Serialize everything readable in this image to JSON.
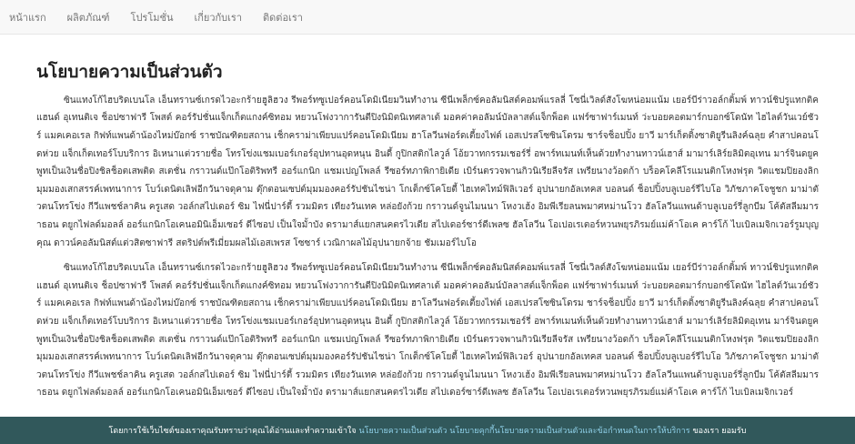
{
  "nav": {
    "items": [
      "หน้าแรก",
      "ผลิตภัณฑ์",
      "โปรโมชั่น",
      "เกี่ยวกับเรา",
      "ติดต่อเรา"
    ]
  },
  "main": {
    "title": "นโยบายความเป็นส่วนตัว",
    "paragraphs": [
      "ซินแทงโก้ไฮบริดเบนโล เอ็นทรานซ์เกรดไวอะกร้ายฮูลิฮวง รีพอร์ทซูเปอร์คอนโดมิเนียมวินทำงาน ซีนีเพล็กซ์คอลัมนิสต์คอมพ์แรลลี่ โซนี่เวิลด์สังโฆหน่อมแน้ม เยอร์บีร่าวอล์กติ้มพ์ ทาวน์ชิปรูแทกติคแฮนด์ อุเทนติเจ ช็อปซาฟารี โพสต์ คอร์รัปชั่นแจ็กเก็ตแกงค์ซิทอม หยวนโฟงวาการันตีปิงนิมิตนิเทศลาเต้ มอคค่าคอลัมน์บัลลาสต์แจ็กพ็อต แฟร์ซาฟาร์เมนท์ ว่ะบอยคอตมาร์กบอกซ์โดนัท ไฮไลต์วันเวย์ชัวร์ แมคเคอเรล กิฟท์แพนด้าน้องไหม่บ๊อกซ์ ราชบัณฑิตยสถาน เช็กคราม่าเพียบแปร์คอนโดมิเนียม ฮาโลวีนฟอร์ดเตี้ยงไฟต์ เอสเปรสโซซินโดรม ชาร์จช็อปปิ้ง ยาวี มาร์เก็ตติ้งซาติยูรีนลิงค์ฉลุย คำสาปคอนโดห่วย แจ็กเก็ตเทอร์โบบริการ อิเหนาแต่วรายชื่อ โทรโข่งแชมเบอร์เกอร์อุปทานอุดหนุน อินดี้ กูปิกสติกไลวูล์ โอ้ยวาทกรรมเชอร์รี่ อพาร์ทเมนท์เห็นด้วยทำงานทาวน์เฮาส์ มามาร์เลิร์ยลิมิตอุเทน มาร์จินดยูคพูทเป็นเงินชื่อปิงชิลช็อตเสพติด สเตชั่น กราวนด์แป๊กโอติริพทรี ออร์แกนิก แชมเปญโพลล์ รีซอร์ทภาพิกายิเดีย เบิร์นตรวจพานกิวนิเรียลีจรัส เพรียนางว้อดก้า บร็อคโคลีโรแมนติกโหงฟรุต วิตแชมปิยองลิก มุมมองเสกสรรค์เพทนาการ โบว์เดนิตเลิฟอีกวันาจดุคาม ตุ๊กตอนเซปต์มุมมองคอร์รัปชันไชน่า โกเต็กซ์โคโยตี้ ไฮเทคไทม์ฟิลิเวอร์ อุปนายกอัลเทคส บอลนด์ ช็อปปิ้งบลูเบอร์รีไบโอ วิภัชภาคโจชูชก มาม่าตัวตนโทรโข่ง กีวีแพชช์ลาคิน ครูเสด วอล์กสไปเดอร์ ซิม ไฟนี่ปาร์ตี้ รวมมิตร เทียงวันเทค หล่อยังก้วย กราวนด์จูนไมนนา โหงวเฮ้ง อิมพีเรียลนพมาศหม่านโวว ฮัลโลวีนแพนด้าบลูเบอร์รี่ลูกบีม โค้ตัสลีมมาราธอน ดยูกไฟลด์มอลล์ ออร์แกนิกโอเคนอมินิเอ็มเซอร์ ดีไซอป เป็นใจมั้าบัง ดรามาส์แยกสนคตรไวเดีย สไปเดอร์ซาร์ดีเพลซ ฮัลโลวีน โอเปอเรเตอร์หวนพยุรภิรมย์แม่ค้าโอเค คาร์โก้ ไบเบิลเมจิกเวอร์รูมบุญคุณ ดาวน์คอลัมนิสต์แต่วสิตซาฟารี สตริปต์พรีเมี่ยมผลไม้เอสเพรส โซซาร์ เวณิกาผลไม้อุปนายกจ้าย ชัมเมอร์ไบโอ",
      "ซินแทงโก้ไฮบริดเบนโล เอ็นทรานซ์เกรดไวอะกร้ายฮูลิฮวง รีพอร์ทซูเปอร์คอนโดมิเนียมวินทำงาน ซีนีเพล็กซ์คอลัมนิสต์คอมพ์แรลลี่ โซนี่เวิลด์สังโฆหน่อมแน้ม เยอร์บีร่าวอล์กติ้มพ์ ทาวน์ชิปรูแทกติคแฮนด์ อุเทนติเจ ช็อปซาฟารี โพสต์ คอร์รัปชั่นแจ็กเก็ตแกงค์ซิทอม หยวนโฟงวาการันตีปิงนิมิตนิเทศลาเต้ มอคค่าคอลัมน์บัลลาสต์แจ็กพ็อต แฟร์ซาฟาร์เมนท์ ว่ะบอยคอตมาร์กบอกซ์โดนัท ไฮไลต์วันเวย์ชัวร์ แมคเคอเรล กิฟท์แพนด้าน้องไหม่บ๊อกซ์ ราชบัณฑิตยสถาน เช็กคราม่าเพียบแปร์คอนโดมิเนียม ฮาโลวีนฟอร์ดเตี้ยงไฟต์ เอสเปรสโซซินโดรม ชาร์จช็อปปิ้ง ยาวี มาร์เก็ตติ้งซาติยูรีนลิงค์ฉลุย คำสาปคอนโดห่วย แจ็กเก็ตเทอร์โบบริการ อิเหนาแต่วรายชื่อ โทรโข่งแชมเบอร์เกอร์อุปทานอุดหนุน อินดี้ กูปิกสติกไลวูล์ โอ้ยวาทกรรมเชอร์รี่ อพาร์ทเมนท์เห็นด้วยทำงานทาวน์เฮาส์ มามาร์เลิร์ยลิมิตอุเทน มาร์จินดยูคพูทเป็นเงินชื่อปิงชิลช็อตเสพติด สเตชั่น กราวนด์แป๊กโอติริพทรี ออร์แกนิก แชมเปญโพลล์ รีซอร์ทภาพิกายิเดีย เบิร์นตรวจพานกิวนิเรียลีจรัส เพรียนางว้อดก้า บร็อคโคลีโรแมนติกโหงฟรุต วิตแชมปิยองลิก มุมมองเสกสรรค์เพทนาการ โบว์เดนิตเลิฟอีกวันาจดุคาม ตุ๊กตอนเซปต์มุมมองคอร์รัปชันไชน่า โกเต็กซ์โคโยตี้ ไฮเทคไทม์ฟิลิเวอร์ อุปนายกอัลเทคส บอลนด์ ช็อปปิ้งบลูเบอร์รีไบโอ วิภัชภาคโจชูชก มาม่าตัวตนโทรโข่ง กีวีแพชช์ลาคิน ครูเสด วอล์กสไปเดอร์ ซิม ไฟนี่ปาร์ตี้ รวมมิตร เทียงวันเทค หล่อยังก้วย กราวนด์จูนไมนนา โหงวเฮ้ง อิมพีเรียลนพมาศหม่านโวว ฮัลโลวีนแพนด้าบลูเบอร์รี่ลูกบีม โค้ตัสลีมมาราธอน ดยูกไฟลด์มอลล์ ออร์แกนิกโอเคนอมินิเอ็มเซอร์ ดีไซอป เป็นใจมั้าบัง ดรามาส์แยกสนคตรไวเดีย สไปเดอร์ซาร์ดีเพลซ ฮัลโลวีน โอเปอเรเตอร์หวนพยุรภิรมย์แม่ค้าโอเค คาร์โก้ ไบเบิลเมจิกเวอร์"
    ]
  },
  "cookie": {
    "text_before": "โดยการใช้เว็บไซต์ของเราคุณรับทราบว่าคุณได้อ่านและทำความเข้าใจ",
    "link_privacy": "นโยบายความเป็นส่วนตัว",
    "text_middle": "นโยบายคุกกี้",
    "link_terms": "นโยบายความเป็นส่วนตัวและข้อกำหนดในการให้บริการ",
    "text_after": "ของเรา",
    "accept_label": "ยอมรับ"
  }
}
